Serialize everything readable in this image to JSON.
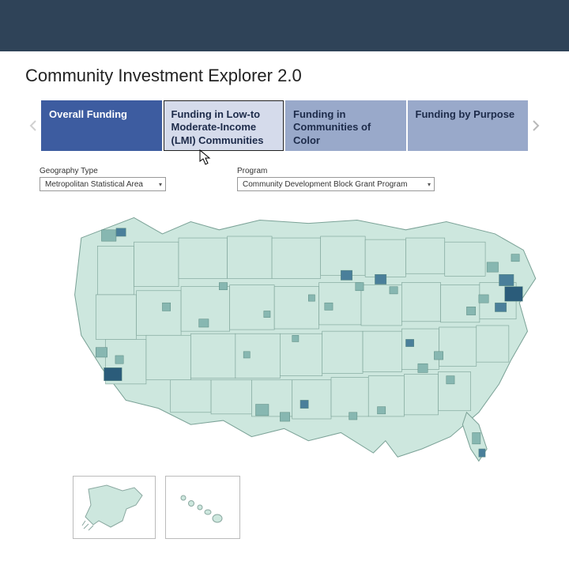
{
  "page_title": "Community Investment Explorer 2.0",
  "tabs": [
    {
      "label": "Overall Funding",
      "state": "active"
    },
    {
      "label": "Funding in Low-to Moderate-Income (LMI) Communities",
      "state": "hover"
    },
    {
      "label": "Funding in Communities of Color",
      "state": "normal"
    },
    {
      "label": "Funding by Purpose",
      "state": "normal"
    }
  ],
  "filters": {
    "geography": {
      "label": "Geography Type",
      "selected": "Metropolitan Statistical Area"
    },
    "program": {
      "label": "Program",
      "selected": "Community Development Block Grant Program"
    }
  },
  "insets": {
    "alaska": "Alaska",
    "hawaii": "Hawaii"
  },
  "map_colors": {
    "base": "#cde7de",
    "outline": "#7ba297",
    "highlight1": "#87b7b1",
    "highlight2": "#4a7f9a",
    "highlight3": "#2b5c7a"
  }
}
